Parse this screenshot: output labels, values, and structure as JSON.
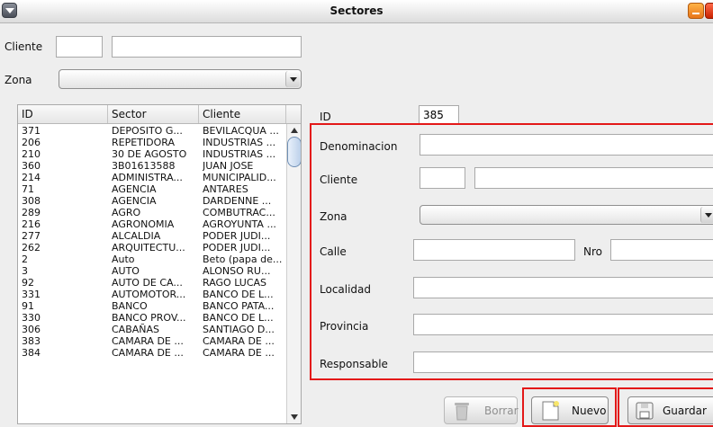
{
  "window": {
    "title": "Sectores"
  },
  "filter": {
    "cliente_label": "Cliente",
    "cliente_code": "",
    "cliente_name": "",
    "zona_label": "Zona",
    "zona_value": ""
  },
  "table": {
    "headers": [
      "ID",
      "Sector",
      "Cliente"
    ],
    "rows": [
      [
        "371",
        "DEPOSITO G...",
        "BEVILACQUA ..."
      ],
      [
        "206",
        "REPETIDORA",
        "INDUSTRIAS ..."
      ],
      [
        "210",
        "30 DE AGOSTO",
        "INDUSTRIAS ..."
      ],
      [
        "360",
        "3B01613588",
        "JUAN JOSE"
      ],
      [
        "214",
        "ADMINISTRA...",
        "MUNICIPALID..."
      ],
      [
        "71",
        "AGENCIA",
        "ANTARES"
      ],
      [
        "308",
        "AGENCIA",
        "DARDENNE ..."
      ],
      [
        "289",
        "AGRO",
        "COMBUTRAC..."
      ],
      [
        "216",
        "AGRONOMIA",
        "AGROYUNTA ..."
      ],
      [
        "277",
        "ALCALDIA",
        "PODER JUDI..."
      ],
      [
        "262",
        "ARQUITECTU...",
        "PODER JUDI..."
      ],
      [
        "2",
        "Auto",
        "Beto (papa de..."
      ],
      [
        "3",
        "AUTO",
        "ALONSO RU..."
      ],
      [
        "92",
        "AUTO DE CA...",
        "RAGO LUCAS"
      ],
      [
        "331",
        "AUTOMOTOR...",
        "BANCO DE L..."
      ],
      [
        "91",
        "BANCO",
        "BANCO PATA..."
      ],
      [
        "330",
        "BANCO PROV...",
        "BANCO DE L..."
      ],
      [
        "306",
        "CABAÑAS",
        "SANTIAGO D..."
      ],
      [
        "383",
        "CAMARA DE ...",
        "CAMARA DE ..."
      ],
      [
        "384",
        "CAMARA DE ...",
        "CAMARA DE ..."
      ]
    ]
  },
  "form": {
    "id_label": "ID",
    "id_value": "385",
    "denominacion_label": "Denominacion",
    "denominacion_value": "",
    "cliente_label": "Cliente",
    "cliente_code": "",
    "cliente_name": "",
    "zona_label": "Zona",
    "zona_value": "",
    "calle_label": "Calle",
    "calle_value": "",
    "nro_label": "Nro",
    "nro_value": "",
    "localidad_label": "Localidad",
    "localidad_value": "",
    "provincia_label": "Provincia",
    "provincia_value": "",
    "responsable_label": "Responsable",
    "responsable_value": ""
  },
  "buttons": {
    "borrar": "Borrar",
    "nuevo": "Nuevo",
    "guardar": "Guardar"
  },
  "colors": {
    "highlight": "#e31818",
    "title_bar": "#dcdcdc"
  },
  "icons": {
    "borrar": "trash-icon",
    "nuevo": "new-document-icon",
    "guardar": "save-icon"
  }
}
